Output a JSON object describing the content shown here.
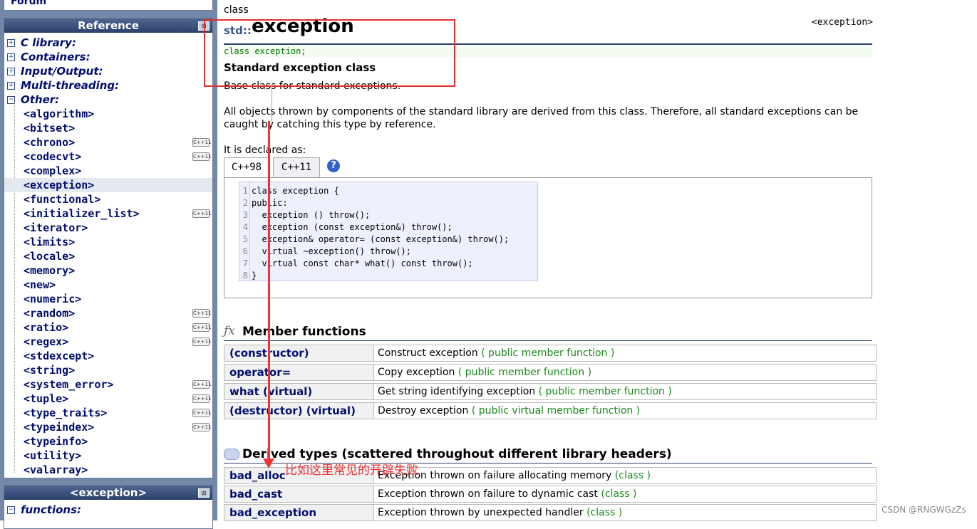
{
  "sidebar": {
    "forum": "Forum",
    "reference": {
      "title": "Reference",
      "categories": [
        "C library:",
        "Containers:",
        "Input/Output:",
        "Multi-threading:",
        "Other:"
      ],
      "headers": [
        {
          "name": "<algorithm>",
          "cpp11": false
        },
        {
          "name": "<bitset>",
          "cpp11": false
        },
        {
          "name": "<chrono>",
          "cpp11": true
        },
        {
          "name": "<codecvt>",
          "cpp11": true
        },
        {
          "name": "<complex>",
          "cpp11": false
        },
        {
          "name": "<exception>",
          "cpp11": false,
          "selected": true
        },
        {
          "name": "<functional>",
          "cpp11": false
        },
        {
          "name": "<initializer_list>",
          "cpp11": true
        },
        {
          "name": "<iterator>",
          "cpp11": false
        },
        {
          "name": "<limits>",
          "cpp11": false
        },
        {
          "name": "<locale>",
          "cpp11": false
        },
        {
          "name": "<memory>",
          "cpp11": false
        },
        {
          "name": "<new>",
          "cpp11": false
        },
        {
          "name": "<numeric>",
          "cpp11": false
        },
        {
          "name": "<random>",
          "cpp11": true
        },
        {
          "name": "<ratio>",
          "cpp11": true
        },
        {
          "name": "<regex>",
          "cpp11": true
        },
        {
          "name": "<stdexcept>",
          "cpp11": false
        },
        {
          "name": "<string>",
          "cpp11": false
        },
        {
          "name": "<system_error>",
          "cpp11": true
        },
        {
          "name": "<tuple>",
          "cpp11": true
        },
        {
          "name": "<type_traits>",
          "cpp11": true
        },
        {
          "name": "<typeindex>",
          "cpp11": true
        },
        {
          "name": "<typeinfo>",
          "cpp11": false
        },
        {
          "name": "<utility>",
          "cpp11": false
        },
        {
          "name": "<valarray>",
          "cpp11": false
        }
      ],
      "cpp11_label": "C++11"
    },
    "exception_panel": {
      "title": "<exception>",
      "first_item": "functions:"
    }
  },
  "main": {
    "kind": "class",
    "ns": "std::",
    "name": "exception",
    "header": "<exception>",
    "prototype": "class exception;",
    "subtitle": "Standard exception class",
    "desc1": "Base class for standard exceptions.",
    "desc2": "All objects thrown by components of the standard library are derived from this class. Therefore, all standard exceptions can be caught by catching this type by reference.",
    "declared": "It is declared as:",
    "tabs": [
      "C++98",
      "C++11"
    ],
    "help": "?",
    "code": [
      "class exception {",
      "public:",
      "  exception () throw();",
      "  exception (const exception&) throw();",
      "  exception& operator= (const exception&) throw();",
      "  virtual ~exception() throw();",
      "  virtual const char* what() const throw();",
      "}"
    ],
    "members_title": "Member functions",
    "members": [
      {
        "name": "(constructor)",
        "desc": "Construct exception",
        "kind": "( public member function )"
      },
      {
        "name": "operator=",
        "desc": "Copy exception",
        "kind": "( public member function )"
      },
      {
        "name": "what (virtual)",
        "desc": "Get string identifying exception",
        "kind": "( public member function )"
      },
      {
        "name": "(destructor) (virtual)",
        "desc": "Destroy exception",
        "kind": "( public virtual member function )"
      }
    ],
    "derived_title": "Derived types (scattered throughout different library headers)",
    "derived": [
      {
        "name": "bad_alloc",
        "desc": "Exception thrown on failure allocating memory",
        "kind": "(class )"
      },
      {
        "name": "bad_cast",
        "desc": "Exception thrown on failure to dynamic cast",
        "kind": "(class )"
      },
      {
        "name": "bad_exception",
        "desc": "Exception thrown by unexpected handler",
        "kind": "(class )"
      }
    ],
    "fx_icon": "function-icon",
    "annotation": "比如这里常见的开辟失败",
    "watermark": "CSDN @RNGWGzZs"
  },
  "colors": {
    "annotation": "#e33333",
    "sidebar_bg": "#7388a8",
    "link": "#000e6e",
    "kind": "#1a8a1a"
  }
}
